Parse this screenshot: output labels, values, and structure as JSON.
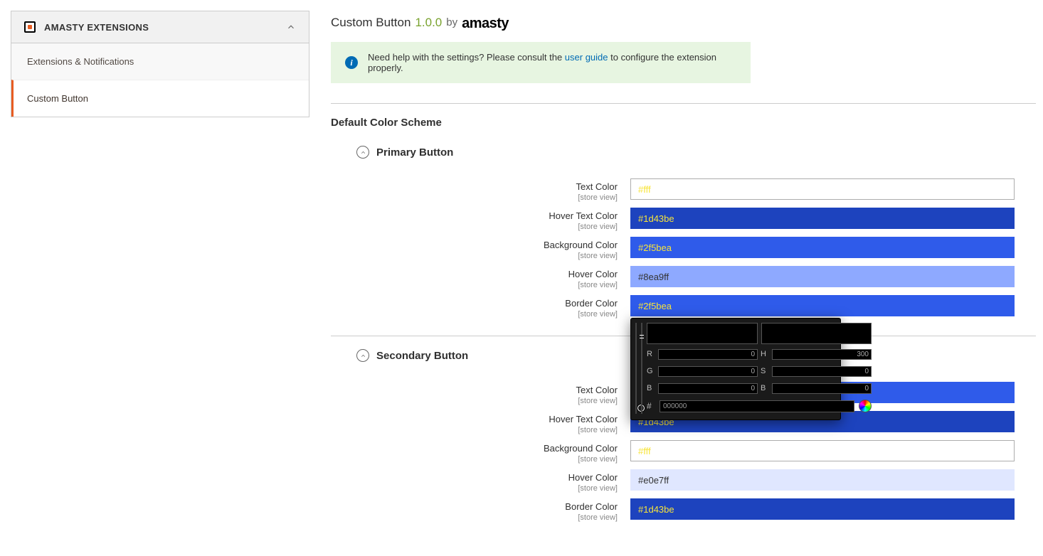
{
  "sidebar": {
    "header": "AMASTY EXTENSIONS",
    "items": [
      {
        "label": "Extensions & Notifications",
        "active": false
      },
      {
        "label": "Custom Button",
        "active": true
      }
    ]
  },
  "page": {
    "title": "Custom Button",
    "version": "1.0.0",
    "by": "by",
    "brand": "amasty"
  },
  "notice": {
    "pre": "Need help with the settings? Please consult the ",
    "link": "user guide",
    "post": " to configure the extension properly."
  },
  "section_title": "Default Color Scheme",
  "scope_label": "[store view]",
  "primary": {
    "heading": "Primary Button",
    "fields": {
      "text_color": {
        "label": "Text Color",
        "value": "#fff",
        "bg": "#ffffff",
        "txt": "yellow"
      },
      "hover_text_color": {
        "label": "Hover Text Color",
        "value": "#1d43be",
        "bg": "#1d43be",
        "txt": "yellow"
      },
      "background_color": {
        "label": "Background Color",
        "value": "#2f5bea",
        "bg": "#2f5bea",
        "txt": "yellow"
      },
      "hover_color": {
        "label": "Hover Color",
        "value": "#8ea9ff",
        "bg": "#8ea9ff",
        "txt": "dark"
      },
      "border_color": {
        "label": "Border Color",
        "value": "#2f5bea",
        "bg": "#2f5bea",
        "txt": "yellow"
      }
    }
  },
  "secondary": {
    "heading": "Secondary Button",
    "fields": {
      "text_color": {
        "label": "Text Color",
        "value": "",
        "bg": "#2f5bea",
        "txt": "yellow"
      },
      "hover_text_color": {
        "label": "Hover Text Color",
        "value": "#1d43be",
        "bg": "#1d43be",
        "txt": "yellow"
      },
      "background_color": {
        "label": "Background Color",
        "value": "#fff",
        "bg": "#ffffff",
        "txt": "yellow"
      },
      "hover_color": {
        "label": "Hover Color",
        "value": "#e0e7ff",
        "bg": "#e0e7ff",
        "txt": "dark"
      },
      "border_color": {
        "label": "Border Color",
        "value": "#1d43be",
        "bg": "#1d43be",
        "txt": "yellow"
      }
    }
  },
  "picker": {
    "R": "0",
    "G": "0",
    "B": "0",
    "H": "300",
    "S": "0",
    "Bv": "0",
    "hex": "000000"
  }
}
